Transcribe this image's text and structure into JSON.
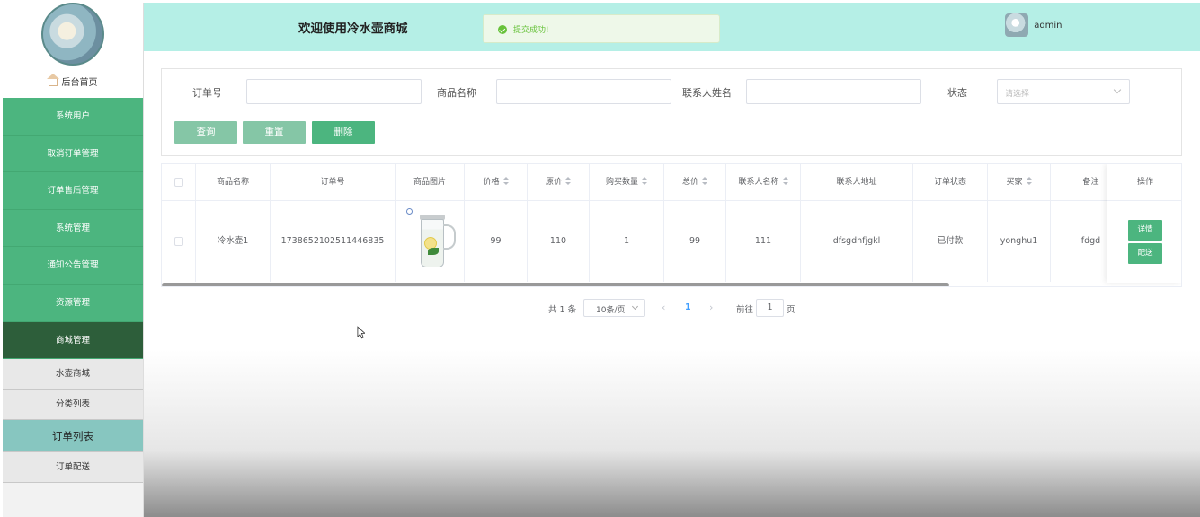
{
  "header": {
    "title": "欢迎使用冷水壶商城",
    "toast": "提交成功!",
    "user": "admin"
  },
  "sidebar": {
    "home": "后台首页",
    "menu": [
      "系统用户",
      "取消订单管理",
      "订单售后管理",
      "系统管理",
      "通知公告管理",
      "资源管理",
      "商城管理"
    ],
    "active_menu": "商城管理",
    "submenu": [
      "水壶商城",
      "分类列表",
      "订单列表",
      "订单配送"
    ],
    "active_submenu": "订单列表"
  },
  "search": {
    "order_no_label": "订单号",
    "product_name_label": "商品名称",
    "contact_name_label": "联系人姓名",
    "status_label": "状态",
    "status_placeholder": "请选择",
    "query_button": "查询",
    "reset_button": "重置",
    "delete_button": "删除"
  },
  "table": {
    "columns": [
      "商品名称",
      "订单号",
      "商品图片",
      "价格",
      "原价",
      "购买数量",
      "总价",
      "联系人名称",
      "联系人地址",
      "订单状态",
      "买家",
      "备注",
      "操作"
    ],
    "rows": [
      {
        "product_name": "冷水壶1",
        "order_no": "1738652102511446835",
        "image": "water-jug",
        "price": "99",
        "original_price": "110",
        "quantity": "1",
        "total": "99",
        "contact_name": "111",
        "contact_address": "dfsgdhfjgkl",
        "status": "已付款",
        "buyer": "yonghu1",
        "remark": "fdgd",
        "actions": [
          "详情",
          "配送"
        ]
      }
    ]
  },
  "pagination": {
    "total": "共 1 条",
    "page_size": "10条/页",
    "current_page": "1",
    "goto_label": "前往",
    "goto_value": "1",
    "page_unit": "页"
  },
  "colors": {
    "header_bg": "#b5efe6",
    "menu_green": "#4cb57f",
    "menu_active": "#2d5e3a",
    "success": "#67c23a"
  }
}
